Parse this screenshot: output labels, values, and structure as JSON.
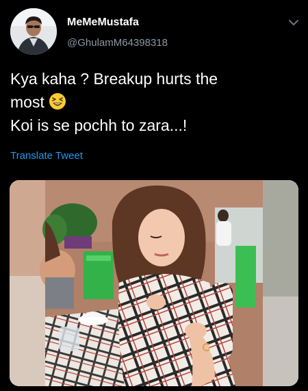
{
  "tweet": {
    "display_name": "MeMeMustafa",
    "handle": "@GhulamM64398318",
    "text_line1": "Kya kaha ? Breakup hurts the",
    "text_line2": "most",
    "text_line3": "Koi is se pochh to zara...!",
    "translate_label": "Translate Tweet",
    "emoji": "laughing-squinting-face"
  },
  "icons": {
    "menu": "chevron-down-icon"
  },
  "colors": {
    "background": "#000000",
    "link": "#1d9bf0",
    "secondary_text": "#8b98a5"
  }
}
